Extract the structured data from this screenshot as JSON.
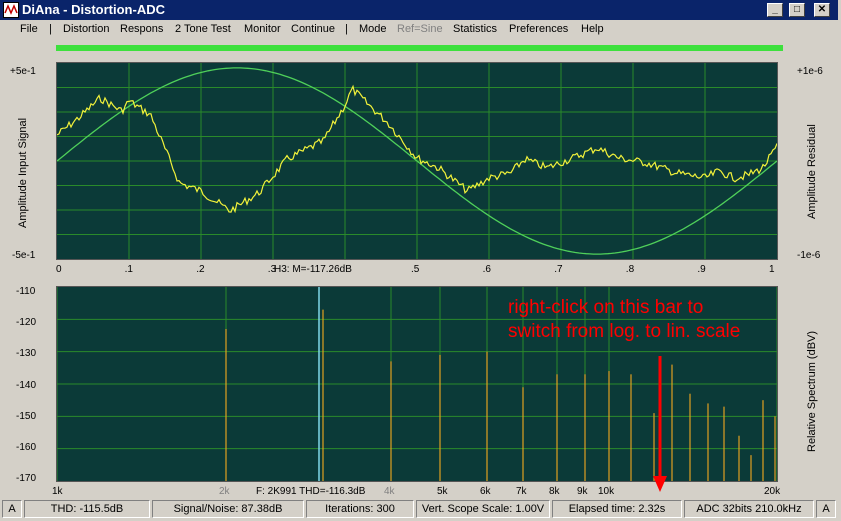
{
  "window": {
    "title": "DiAna - Distortion-ADC"
  },
  "menu": [
    {
      "label": "File",
      "disabled": false
    },
    {
      "label": "|",
      "disabled": false
    },
    {
      "label": "Distortion",
      "disabled": false
    },
    {
      "label": "Respons",
      "disabled": false
    },
    {
      "label": "2 Tone Test",
      "disabled": false
    },
    {
      "label": "Monitor",
      "disabled": false
    },
    {
      "label": "Continue",
      "disabled": false
    },
    {
      "label": "|",
      "disabled": false
    },
    {
      "label": "Mode",
      "disabled": false
    },
    {
      "label": "Ref=Sine",
      "disabled": true
    },
    {
      "label": "Statistics",
      "disabled": false
    },
    {
      "label": "Preferences",
      "disabled": false
    },
    {
      "label": "Help",
      "disabled": false
    }
  ],
  "scope": {
    "left_top": "+5e-1",
    "left_bottom": "-5e-1",
    "right_top": "+1e-6",
    "right_bottom": "-1e-6",
    "left_axis_label": "Amplitude Input Signal",
    "right_axis_label": "Amplitude Residual",
    "x_ticks": [
      "0",
      ".1",
      ".2",
      ".3",
      ".4",
      ".5",
      ".6",
      ".7",
      ".8",
      ".9",
      "1"
    ],
    "h3_readout": "H3: M=-117.26dB",
    "sine_color": "#4fd05a",
    "residual_color": "#f2f23a"
  },
  "spectrum": {
    "y_ticks": [
      "-110",
      "-120",
      "-130",
      "-140",
      "-150",
      "-160",
      "-170"
    ],
    "right_axis_label": "Relative Spectrum (dBV)",
    "x_ticks": [
      {
        "label": "1k",
        "dim": false
      },
      {
        "label": "2k",
        "dim": true
      },
      {
        "label": "4k",
        "dim": true
      },
      {
        "label": "5k",
        "dim": false
      },
      {
        "label": "6k",
        "dim": false
      },
      {
        "label": "7k",
        "dim": false
      },
      {
        "label": "8k",
        "dim": false
      },
      {
        "label": "9k",
        "dim": false
      },
      {
        "label": "10k",
        "dim": false
      },
      {
        "label": "20k",
        "dim": false
      }
    ],
    "readout": "F: 2K991 THD=-116.3dB",
    "annotation_line1": "right-click on this bar to",
    "annotation_line2": "switch from log. to lin. scale",
    "bar_color": "#e0a020",
    "fundamental_color": "#7fd8e8"
  },
  "status": {
    "left_mode": "A",
    "thd": "THD: -115.5dB",
    "snr": "Signal/Noise:  87.38dB",
    "iterations": "Iterations: 300",
    "vscale": "Vert. Scope Scale: 1.00V",
    "elapsed": "Elapsed time: 2.32s",
    "adc": "ADC 32bits 210.0kHz",
    "right_mode": "A"
  },
  "chart_data": [
    {
      "type": "line",
      "title": "",
      "xlabel": "",
      "ylabel": "Amplitude Input Signal",
      "xlim": [
        0,
        1
      ],
      "series": [
        {
          "values_note": "sine",
          "x": [
            0,
            0.25,
            0.5,
            0.75,
            1
          ],
          "y": [
            0,
            0.5,
            0,
            -0.5,
            0
          ]
        }
      ]
    },
    {
      "type": "bar",
      "title": "",
      "ylabel": "Relative Spectrum (dBV)",
      "ylim": [
        -170,
        -110
      ],
      "categories": [
        "2k",
        "2.9k",
        "3k",
        "4k",
        "5k",
        "6k",
        "7k",
        "8k",
        "9k",
        "10k",
        "11k",
        "12k",
        "13k",
        "14k",
        "15k",
        "16k",
        "17k",
        "18k",
        "19k",
        "20k"
      ],
      "values": [
        -123,
        -110,
        -117,
        -133,
        -131,
        -130,
        -141,
        -137,
        -137,
        -136,
        -137,
        -149,
        -134,
        -143,
        -146,
        -147,
        -156,
        -162,
        -145,
        -150
      ]
    }
  ]
}
